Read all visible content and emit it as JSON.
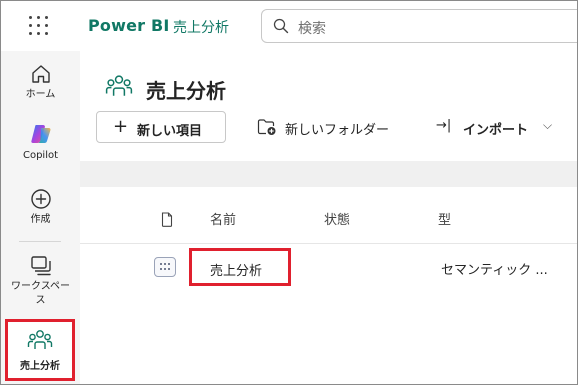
{
  "header": {
    "app_name": "Power BI",
    "breadcrumb": "売上分析",
    "search_placeholder": "検索"
  },
  "rail": {
    "items": [
      {
        "label": "ホーム",
        "icon": "home-icon"
      },
      {
        "label": "Copilot",
        "icon": "copilot-icon"
      },
      {
        "label": "作成",
        "icon": "create-icon"
      },
      {
        "label": "ワークスペース",
        "icon": "workspaces-icon"
      },
      {
        "label": "売上分析",
        "icon": "workspace-people-icon",
        "active": true
      }
    ]
  },
  "workspace": {
    "title": "売上分析",
    "icon": "workspace-people-icon"
  },
  "toolbar": {
    "new_item": "新しい項目",
    "new_folder": "新しいフォルダー",
    "import": "インポート",
    "import_arrow": "→|"
  },
  "table": {
    "columns": [
      "名前",
      "状態",
      "型"
    ],
    "rows": [
      {
        "name": "売上分析",
        "status": "",
        "type": "セマンティック ..."
      }
    ]
  },
  "colors": {
    "brand": "#117865",
    "highlight": "#e0202e"
  }
}
